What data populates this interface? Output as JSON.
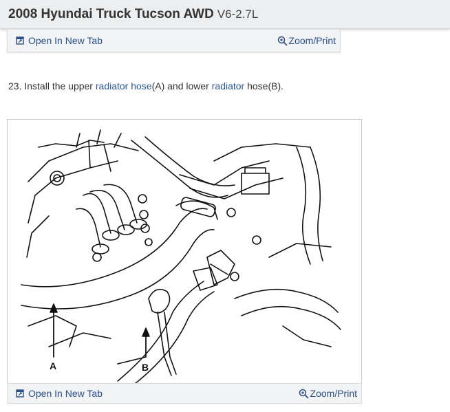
{
  "header": {
    "title_main": "2008 Hyundai Truck Tucson AWD",
    "title_sub": "V6-2.7L"
  },
  "top_bar": {
    "open_tab_label": "Open In New Tab",
    "zoom_label": "Zoom/Print",
    "open_tab_icon": "external-window-icon",
    "zoom_icon": "magnifier-icon"
  },
  "step": {
    "prefix": "23. Install the upper ",
    "link1": "radiator hose",
    "mid1": "(A) and lower ",
    "link2": "radiator",
    "suffix": " hose(B)."
  },
  "figure": {
    "label_a": "A",
    "label_b": "B"
  },
  "bottom_bar": {
    "open_tab_label": "Open In New Tab",
    "zoom_label": "Zoom/Print"
  },
  "colors": {
    "link": "#2a4f8a",
    "header_bg": "#eceeef",
    "bar_bg": "#f2f3f4"
  }
}
